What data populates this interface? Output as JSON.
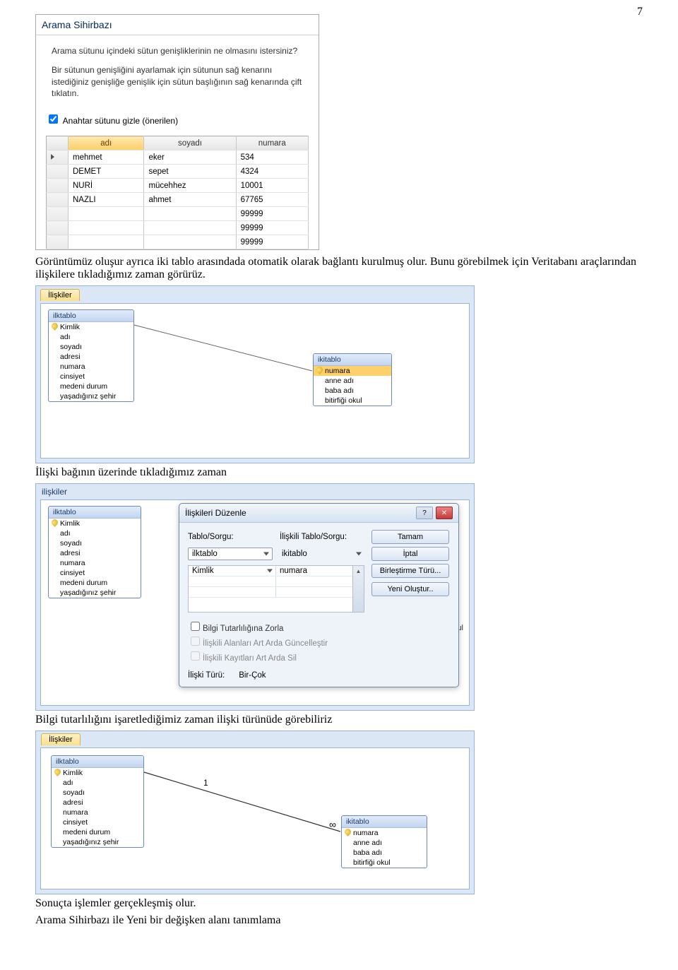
{
  "page_number": "7",
  "paragraphs": {
    "p1": "Görüntümüz oluşur ayrıca iki tablo arasındada otomatik olarak bağlantı kurulmuş olur. Bunu görebilmek için Veritabanı araçlarından ilişkilere tıkladığımız zaman görürüz.",
    "p2": "İlişki bağının üzerinde tıkladığımız zaman",
    "p3": "Bilgi tutarlılığını işaretlediğimiz zaman ilişki türünüde görebiliriz",
    "p4": "Sonuçta işlemler gerçekleşmiş olur.",
    "p5": "Arama Sihirbazı ile Yeni bir değişken alanı tanımlama"
  },
  "wizard": {
    "title": "Arama Sihirbazı",
    "prompt_line1": "Arama sütunu içindeki sütun genişliklerinin ne olmasını istersiniz?",
    "prompt_line2": "Bir sütunun genişliğini ayarlamak için sütunun sağ kenarını istediğiniz genişliğe\n genişlik için sütun başlığının sağ kenarında çift tıklatın.",
    "checkbox_label": "Anahtar sütunu gizle (önerilen)",
    "columns": [
      "adı",
      "soyadı",
      "numara"
    ],
    "rows": [
      [
        "mehmet",
        "eker",
        "534"
      ],
      [
        "DEMET",
        "sepet",
        "4324"
      ],
      [
        "NURİ",
        "mücehhez",
        "10001"
      ],
      [
        "NAZLI",
        "ahmet",
        "67765"
      ],
      [
        "",
        "",
        "99999"
      ],
      [
        "",
        "",
        "99999"
      ],
      [
        "",
        "",
        "99999"
      ]
    ]
  },
  "relations_small": {
    "tab": "İlişkiler",
    "left_table": {
      "title": "ilktablo",
      "fields": [
        "Kimlik",
        "adı",
        "soyadı",
        "adresi",
        "numara",
        "cinsiyet",
        "medeni durum",
        "yaşadığınız şehir"
      ]
    },
    "right_table": {
      "title": "ikitablo",
      "fields": [
        "numara",
        "anne adı",
        "baba adı",
        "bitirfiği okul"
      ]
    }
  },
  "relations_panel": {
    "tab": "ilişkiler",
    "left_table": {
      "title": "ilktablo",
      "fields": [
        "Kimlik",
        "adı",
        "soyadı",
        "adresi",
        "numara",
        "cinsiyet",
        "medeni durum",
        "yaşadığınız şehir"
      ]
    },
    "right_fragment": "kul"
  },
  "edit_dialog": {
    "title": "İlişkileri Düzenle",
    "label_table": "Tablo/Sorgu:",
    "label_related": "İlişkili Tablo/Sorgu:",
    "left_combo": "ilktablo",
    "right_combo": "ikitablo",
    "row_left": "Kimlik",
    "row_right": "numara",
    "btn_ok": "Tamam",
    "btn_cancel": "İptal",
    "btn_join": "Birleştirme Türü...",
    "btn_new": "Yeni Oluştur..",
    "chk1": "Bilgi Tutarlılığına Zorla",
    "chk2": "İlişkili Alanları Art Arda Güncelleştir",
    "chk3": "İlişkili Kayıtları Art Arda Sil",
    "reltype_label": "İlişki Türü:",
    "reltype_value": "Bir-Çok"
  },
  "relations_final": {
    "tab": "İlişkiler",
    "left_table": {
      "title": "ilktablo",
      "fields": [
        "Kimlik",
        "adı",
        "soyadı",
        "adresi",
        "numara",
        "cinsiyet",
        "medeni durum",
        "yaşadığınız şehir"
      ]
    },
    "right_table": {
      "title": "ikitablo",
      "fields": [
        "numara",
        "anne adı",
        "baba adı",
        "bitirfiği okul"
      ]
    },
    "card_left": "1",
    "card_right": "∞"
  }
}
